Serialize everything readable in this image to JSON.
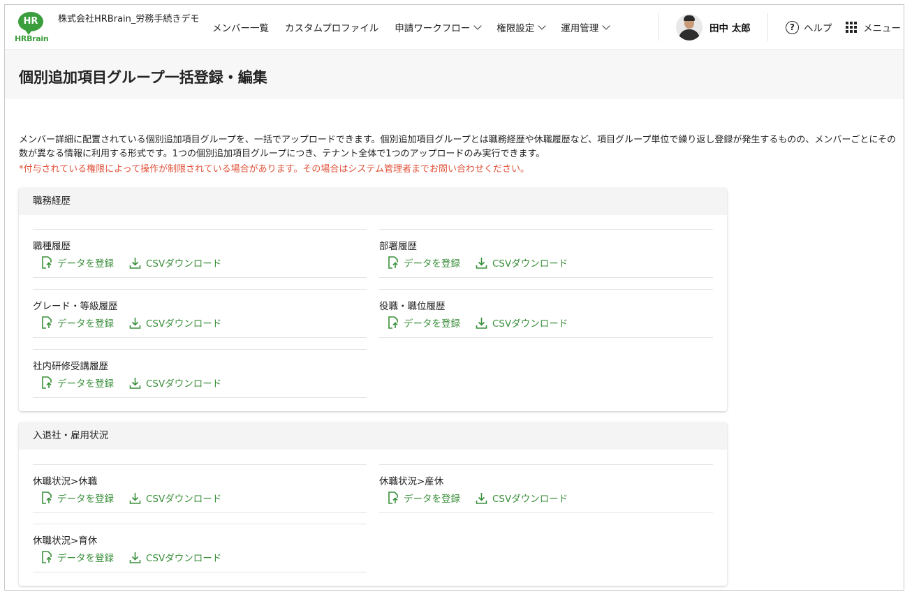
{
  "header": {
    "logo_badge": "HR",
    "logo_word": "HRBrain",
    "company": "株式会社HRBrain_労務手続きデモ",
    "nav": [
      {
        "label": "メンバー一覧",
        "dropdown": false
      },
      {
        "label": "カスタムプロファイル",
        "dropdown": false
      },
      {
        "label": "申請ワークフロー",
        "dropdown": true
      },
      {
        "label": "権限設定",
        "dropdown": true
      },
      {
        "label": "運用管理",
        "dropdown": true
      }
    ],
    "user_name": "田中 太郎",
    "help_label": "ヘルプ",
    "help_icon": "question-circle-icon",
    "menu_label": "メニュー",
    "menu_icon": "grid-icon"
  },
  "page": {
    "title": "個別追加項目グループ一括登録・編集",
    "description": "メンバー詳細に配置されている個別追加項目グループを、一括でアップロードできます。個別追加項目グループとは職務経歴や休職履歴など、項目グループ単位で繰り返し登録が発生するものの、メンバーごとにその数が異なる情報に利用する形式です。1つの個別追加項目グループにつき、テナント全体で1つのアップロードのみ実行できます。",
    "note": "*付与されている権限によって操作が制限されている場合があります。その場合はシステム管理者までお問い合わせください。"
  },
  "actions": {
    "register_label": "データを登録",
    "download_label": "CSVダウンロード",
    "register_icon": "file-upload-icon",
    "download_icon": "download-icon",
    "accent_color": "#3a8f3b"
  },
  "sections": [
    {
      "title": "職務経歴",
      "items": [
        "職種履歴",
        "部署履歴",
        "グレード・等級履歴",
        "役職・職位履歴",
        "社内研修受講履歴"
      ]
    },
    {
      "title": "入退社・雇用状況",
      "items": [
        "休職状況>休職",
        "休職状況>産休",
        "休職状況>育休"
      ]
    }
  ],
  "colors": {
    "brand": "#3b9e3c",
    "warning": "#e0523a"
  }
}
